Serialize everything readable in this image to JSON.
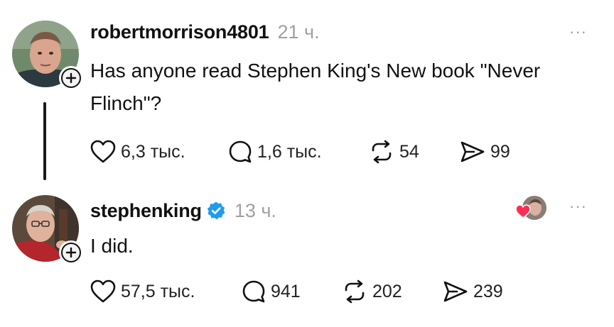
{
  "colors": {
    "text": "#111111",
    "muted": "#a0a0a0",
    "verified": "#1d9bf0",
    "heart": "#ff2d55",
    "thread_line": "#1a1a1a"
  },
  "posts": [
    {
      "username": "robertmorrison4801",
      "time": "21 ч.",
      "text_lines": [
        "Has anyone read Stephen King's New book \"Never",
        "Flinch\"?"
      ],
      "likes": "6,3 тыс.",
      "replies": "1,6 тыс.",
      "reposts": "54",
      "shares": "99",
      "verified": false,
      "avatar_icon": "man-portrait-avatar",
      "more_label": "···"
    },
    {
      "username": "stephenking",
      "time": "13 ч.",
      "text_lines": [
        "I did."
      ],
      "likes": "57,5 тыс.",
      "replies": "941",
      "reposts": "202",
      "shares": "239",
      "verified": true,
      "avatar_icon": "older-man-portrait-avatar",
      "more_label": "···",
      "liked_by_author_icon": "heart-with-avatar-icon"
    }
  ]
}
